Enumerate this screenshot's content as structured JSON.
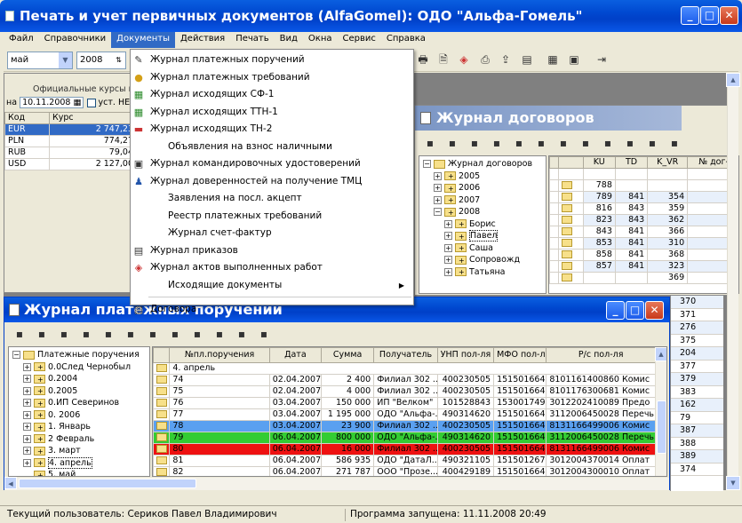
{
  "main_window": {
    "title": "Печать и учет первичных документов (AlfaGomel): ОДО \"Альфа-Гомель\""
  },
  "menubar": [
    "Файл",
    "Справочники",
    "Документы",
    "Действия",
    "Печать",
    "Вид",
    "Окна",
    "Сервис",
    "Справка"
  ],
  "toolbar": {
    "month": "май",
    "year": "2008"
  },
  "rates": {
    "header": "Официальные курсы в",
    "date_prefix": "на",
    "date": "10.11.2008",
    "set_label": "уст. НЕ",
    "col_code": "Код",
    "col_rate": "Курс",
    "rows": [
      {
        "code": "EUR",
        "rate": "2 747,23"
      },
      {
        "code": "PLN",
        "rate": "774,27"
      },
      {
        "code": "RUB",
        "rate": "79,04"
      },
      {
        "code": "USD",
        "rate": "2 127,00"
      }
    ]
  },
  "documents_menu": [
    {
      "label": "Журнал платежных поручений",
      "icon": "journal-edit-icon"
    },
    {
      "label": "Журнал платежных требований",
      "icon": "coins-icon"
    },
    {
      "label": "Журнал исходящих СФ-1",
      "icon": "green-book-icon"
    },
    {
      "label": "Журнал исходящих ТТН-1",
      "icon": "green-book-icon"
    },
    {
      "label": "Журнал исходящих ТН-2",
      "icon": "truck-icon"
    },
    {
      "label": "Объявления на взнос наличными",
      "icon": ""
    },
    {
      "label": "Журнал командировочных удостоверений",
      "icon": "travel-doc-icon"
    },
    {
      "label": "Журнал доверенностей на получение ТМЦ",
      "icon": "person-icon"
    },
    {
      "label": "Заявления на посл. акцепт",
      "icon": ""
    },
    {
      "label": "Реестр платежных требований",
      "icon": ""
    },
    {
      "label": "Журнал счет-фактур",
      "icon": ""
    },
    {
      "label": "Журнал приказов",
      "icon": "order-doc-icon"
    },
    {
      "label": "Журнал актов выполненных работ",
      "icon": "act-icon"
    },
    {
      "label": "Исходящие документы",
      "icon": "",
      "submenu": true
    },
    {
      "label": "Договора",
      "icon": "contract-icon"
    }
  ],
  "contracts": {
    "title": "Журнал договоров",
    "tree": [
      {
        "label": "Журнал договоров",
        "level": 0,
        "sign": "−"
      },
      {
        "label": "2005",
        "level": 1,
        "sign": "+"
      },
      {
        "label": "2006",
        "level": 1,
        "sign": "+"
      },
      {
        "label": "2007",
        "level": 1,
        "sign": "+"
      },
      {
        "label": "2008",
        "level": 1,
        "sign": "−"
      },
      {
        "label": "Борис",
        "level": 2,
        "sign": "+"
      },
      {
        "label": "Павел",
        "level": 2,
        "sign": "+",
        "selected": true
      },
      {
        "label": "Саша",
        "level": 2,
        "sign": "+"
      },
      {
        "label": "Сопровожд",
        "level": 2,
        "sign": "+"
      },
      {
        "label": "Татьяна",
        "level": 2,
        "sign": "+"
      }
    ],
    "columns": [
      "KU",
      "TD",
      "K_VR",
      "№ дог-"
    ],
    "rows": [
      [
        "",
        "",
        "",
        ""
      ],
      [
        "788",
        "",
        "",
        ""
      ],
      [
        "789",
        "841",
        "354",
        ""
      ],
      [
        "816",
        "843",
        "359",
        ""
      ],
      [
        "823",
        "843",
        "362",
        ""
      ],
      [
        "843",
        "841",
        "366",
        ""
      ],
      [
        "853",
        "841",
        "310",
        ""
      ],
      [
        "858",
        "841",
        "368",
        ""
      ],
      [
        "857",
        "841",
        "323",
        ""
      ],
      [
        "",
        "",
        "369",
        ""
      ],
      [
        "",
        "",
        "370",
        ""
      ],
      [
        "",
        "",
        "371",
        ""
      ],
      [
        "",
        "",
        "276",
        ""
      ],
      [
        "",
        "",
        "375",
        ""
      ],
      [
        "",
        "",
        "204",
        ""
      ],
      [
        "",
        "",
        "377",
        ""
      ],
      [
        "",
        "",
        "379",
        ""
      ],
      [
        "",
        "",
        "383",
        ""
      ],
      [
        "",
        "",
        "162",
        ""
      ],
      [
        "",
        "",
        "79",
        ""
      ],
      [
        "",
        "",
        "387",
        ""
      ],
      [
        "",
        "",
        "388",
        ""
      ],
      [
        "",
        "",
        "389",
        ""
      ],
      [
        "",
        "",
        "374",
        ""
      ]
    ]
  },
  "payments": {
    "title": "Журнал платежных поручений",
    "tree": [
      {
        "label": "Платежные поручения",
        "level": 0,
        "sign": "−"
      },
      {
        "label": "0.0След Чернобыл",
        "level": 1,
        "sign": "+"
      },
      {
        "label": "0.2004",
        "level": 1,
        "sign": "+"
      },
      {
        "label": "0.2005",
        "level": 1,
        "sign": "+"
      },
      {
        "label": "0.ИП Северинов",
        "level": 1,
        "sign": "+"
      },
      {
        "label": "0. 2006",
        "level": 1,
        "sign": "+"
      },
      {
        "label": "1. Январь",
        "level": 1,
        "sign": "+"
      },
      {
        "label": "2 Февраль",
        "level": 1,
        "sign": "+"
      },
      {
        "label": "3. март",
        "level": 1,
        "sign": "+"
      },
      {
        "label": "4. апрель",
        "level": 1,
        "sign": "+",
        "selected": true
      },
      {
        "label": "5. май",
        "level": 1,
        "sign": ""
      }
    ],
    "columns": [
      "№пл.поручения",
      "Дата",
      "Сумма",
      "Получатель",
      "УНП пол-ля",
      "МФО пол-ля",
      "Р/с пол-ля"
    ],
    "group": "4. апрель",
    "rows": [
      {
        "cells": [
          "74",
          "02.04.2007",
          "2 400",
          "Филиал 302 ...",
          "400230505",
          "151501664",
          "8101161400860",
          "Комис"
        ],
        "color": ""
      },
      {
        "cells": [
          "75",
          "02.04.2007",
          "4 000",
          "Филиал 302 ...",
          "400230505",
          "151501664",
          "8101176300681",
          "Комис"
        ],
        "color": ""
      },
      {
        "cells": [
          "76",
          "03.04.2007",
          "150 000",
          "ИП \"Велком\"",
          "101528843",
          "153001749",
          "3012202410089",
          "Предо"
        ],
        "color": ""
      },
      {
        "cells": [
          "77",
          "03.04.2007",
          "1 195 000",
          "ОДО \"Альфа-...",
          "490314620",
          "151501664",
          "3112006450028",
          "Перечь"
        ],
        "color": ""
      },
      {
        "cells": [
          "78",
          "03.04.2007",
          "23 900",
          "Филиал 302 ...",
          "400230505",
          "151501664",
          "8131166499006",
          "Комис"
        ],
        "color": "#5aa0f0"
      },
      {
        "cells": [
          "79",
          "06.04.2007",
          "800 000",
          "ОДО \"Альфа-...",
          "490314620",
          "151501664",
          "3112006450028",
          "Перечь"
        ],
        "color": "#33cc33"
      },
      {
        "cells": [
          "80",
          "06.04.2007",
          "16 000",
          "Филиал 302 ...",
          "400230505",
          "151501664",
          "8131166499006",
          "Комис"
        ],
        "color": "#ee1111"
      },
      {
        "cells": [
          "81",
          "06.04.2007",
          "586 935",
          "ОДО \"ДатаЛ...",
          "490321105",
          "151501267",
          "3012004370014",
          "Оплат"
        ],
        "color": ""
      },
      {
        "cells": [
          "82",
          "06.04.2007",
          "271 787",
          "ООО \"Прозе...",
          "400429189",
          "151501664",
          "3012004300010",
          "Оплат"
        ],
        "color": ""
      }
    ]
  },
  "status": {
    "user": "Текущий пользователь: Сериков Павел Владимирович",
    "started": "Программа запущена: 11.11.2008 20:49"
  }
}
